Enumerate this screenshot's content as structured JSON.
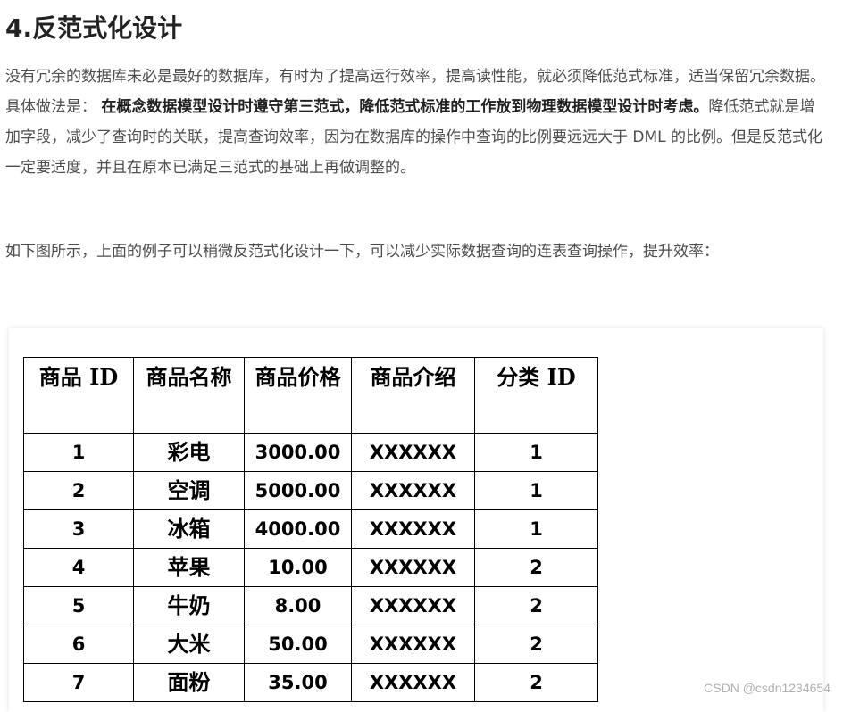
{
  "heading": "4.反范式化设计",
  "paragraph1": {
    "lead": "没有冗余的数据库未必是最好的数据库，有时为了提高运行效率，提高读性能，就必须降低范式标准，适当保留冗余数据。具体做法是：",
    "bold": "在概念数据模型设计时遵守第三范式，降低范式标准的工作放到物理数据模型设计时考虑。",
    "tail": "降低范式就是增加字段，减少了查询时的关联，提高查询效率，因为在数据库的操作中查询的比例要远远大于 DML 的比例。但是反范式化一定要适度，并且在原本已满足三范式的基础上再做调整的。"
  },
  "paragraph2": "如下图所示，上面的例子可以稍微反范式化设计一下，可以减少实际数据查询的连表查询操作，提升效率：",
  "table": {
    "headers": [
      "商品 ID",
      "商品名称",
      "商品价格",
      "商品介绍",
      "分类 ID"
    ],
    "rows": [
      [
        "1",
        "彩电",
        "3000.00",
        "XXXXXX",
        "1"
      ],
      [
        "2",
        "空调",
        "5000.00",
        "XXXXXX",
        "1"
      ],
      [
        "3",
        "冰箱",
        "4000.00",
        "XXXXXX",
        "1"
      ],
      [
        "4",
        "苹果",
        "10.00",
        "XXXXXX",
        "2"
      ],
      [
        "5",
        "牛奶",
        "8.00",
        "XXXXXX",
        "2"
      ],
      [
        "6",
        "大米",
        "50.00",
        "XXXXXX",
        "2"
      ],
      [
        "7",
        "面粉",
        "35.00",
        "XXXXXX",
        "2"
      ]
    ]
  },
  "watermark": "CSDN @csdn1234654"
}
